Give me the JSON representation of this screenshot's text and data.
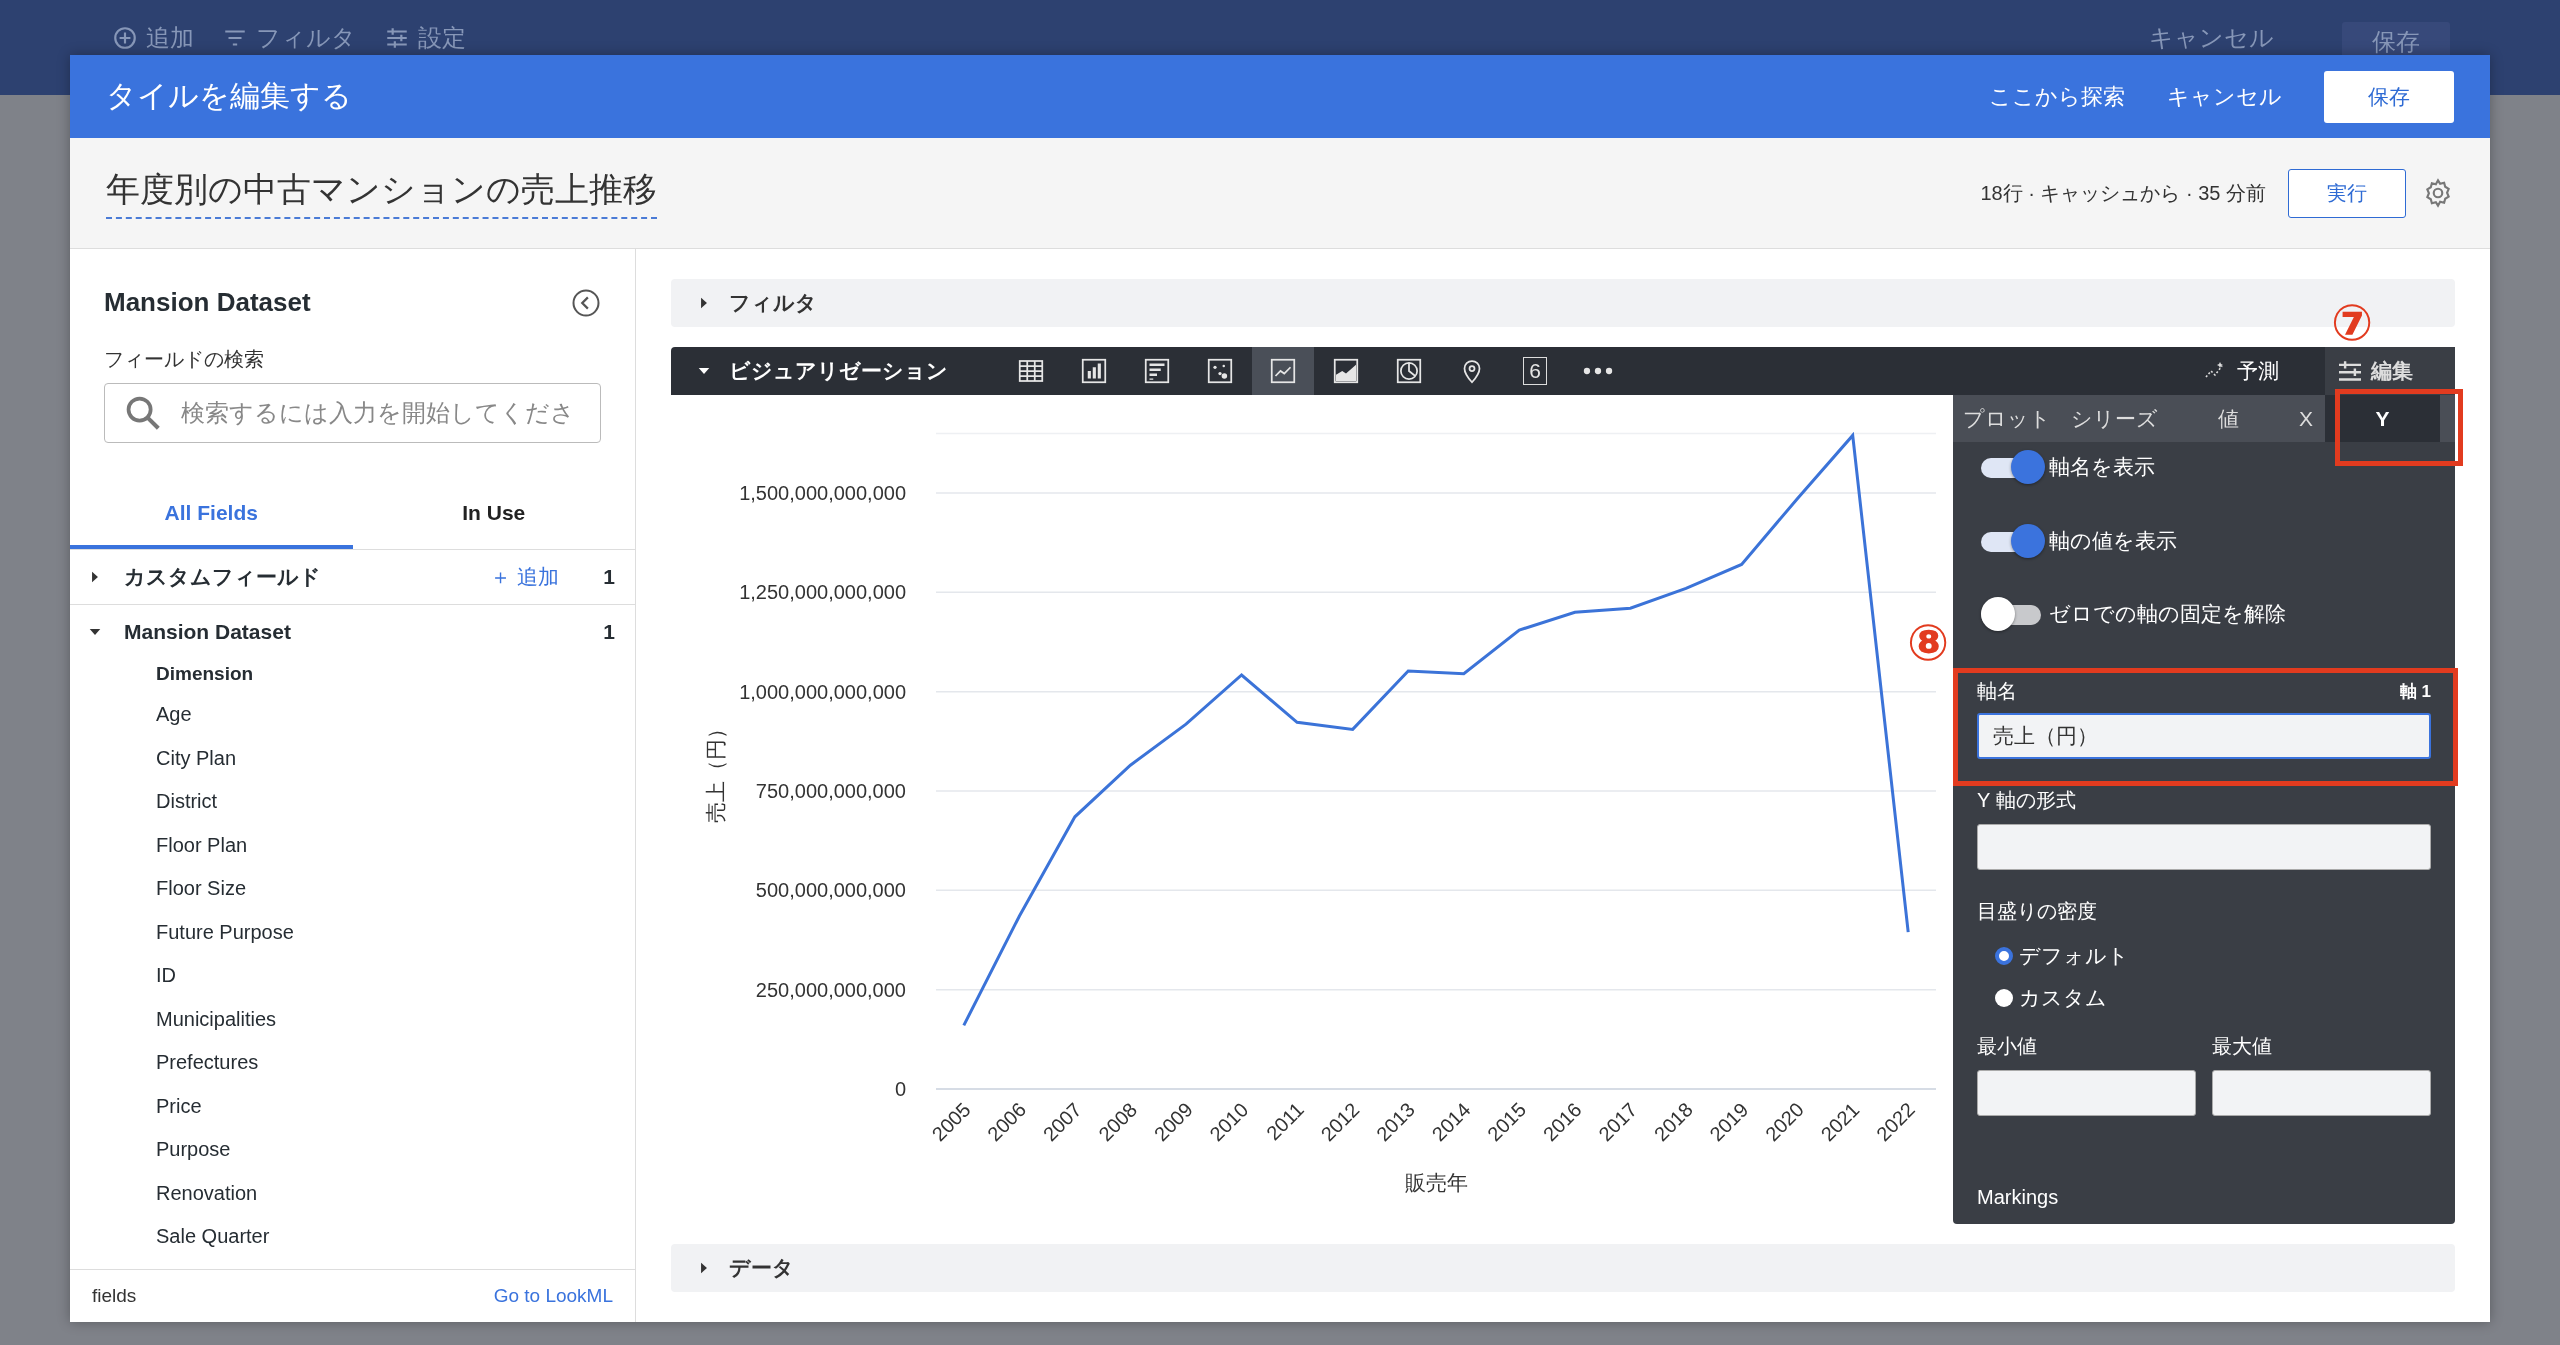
{
  "background_toolbar": {
    "left": [
      {
        "kind": "add",
        "label": "追加"
      },
      {
        "kind": "filter",
        "label": "フィルタ"
      },
      {
        "kind": "settings",
        "label": "設定"
      }
    ],
    "cancel": "キャンセル",
    "save": "保存"
  },
  "modal": {
    "title": "タイルを編集する",
    "actions": {
      "explore": "ここから探索",
      "cancel": "キャンセル",
      "save": "保存"
    },
    "tile_title": "年度別の中古マンションの売上推移",
    "status": "18行 · キャッシュから · 35 分前",
    "run": "実行",
    "field_picker": {
      "title": "Mansion Dataset",
      "search_label": "フィールドの検索",
      "search": {
        "placeholder": "検索するには入力を開始してくださ"
      },
      "tabs": [
        {
          "label": "All Fields",
          "selected": true
        },
        {
          "label": "In Use",
          "selected": false
        }
      ],
      "groups": [
        {
          "label": "カスタムフィールド",
          "expanded": false,
          "add": "＋ 追加",
          "count": "1"
        },
        {
          "label": "Mansion Dataset",
          "expanded": true,
          "count": "1",
          "section": "Dimension",
          "fields": [
            "Age",
            "City Plan",
            "District",
            "Floor Plan",
            "Floor Size",
            "Future Purpose",
            "ID",
            "Municipalities",
            "Prefectures",
            "Price",
            "Purpose",
            "Renovation",
            "Sale Quarter"
          ]
        }
      ],
      "footer": {
        "label": "fields",
        "link": "Go to LookML"
      }
    },
    "filter_section": {
      "label": "フィルタ",
      "expanded": false
    },
    "visualization": {
      "label": "ビジュアリゼーション",
      "expanded": true,
      "types": [
        {
          "kind": "table",
          "selected": false
        },
        {
          "kind": "column",
          "selected": false
        },
        {
          "kind": "bar",
          "selected": false
        },
        {
          "kind": "scatter",
          "selected": false
        },
        {
          "kind": "line",
          "selected": true
        },
        {
          "kind": "area",
          "selected": false
        },
        {
          "kind": "pie",
          "selected": false
        },
        {
          "kind": "map",
          "selected": false
        },
        {
          "kind": "single_value",
          "label": "6",
          "selected": false
        },
        {
          "kind": "more",
          "selected": false
        }
      ],
      "forecast": "予測",
      "edit": "編集",
      "chart_data": {
        "type": "line",
        "xlabel": "販売年",
        "ylabel": "売上（円）",
        "categories": [
          "2005",
          "2006",
          "2007",
          "2008",
          "2009",
          "2010",
          "2011",
          "2012",
          "2013",
          "2014",
          "2015",
          "2016",
          "2017",
          "2018",
          "2019",
          "2020",
          "2021",
          "2022"
        ],
        "series": [
          {
            "color": "#3b73d8",
            "values": [
              160000000000,
              435000000000,
              685000000000,
              815000000000,
              918000000000,
              1042000000000,
              923000000000,
              905000000000,
              1052000000000,
              1045000000000,
              1155000000000,
              1200000000000,
              1210000000000,
              1260000000000,
              1320000000000,
              1485000000000,
              1645000000000,
              395000000000
            ]
          }
        ],
        "grid": true,
        "ylim": [
          0,
          1650000000000
        ],
        "yticks": [
          {
            "value": 0,
            "label": "0"
          },
          {
            "value": 250000000000,
            "label": "250,000,000,000"
          },
          {
            "value": 500000000000,
            "label": "500,000,000,000"
          },
          {
            "value": 750000000000,
            "label": "750,000,000,000"
          },
          {
            "value": 1000000000000,
            "label": "1,000,000,000,000"
          },
          {
            "value": 1250000000000,
            "label": "1,250,000,000,000"
          },
          {
            "value": 1500000000000,
            "label": "1,500,000,000,000"
          }
        ]
      },
      "settings_panel": {
        "tabs": [
          {
            "label": "プロット",
            "selected": false
          },
          {
            "label": "シリーズ",
            "selected": false
          },
          {
            "label": "値",
            "selected": false
          },
          {
            "label": "X",
            "selected": false
          },
          {
            "label": "Y",
            "selected": true
          }
        ],
        "toggles": [
          {
            "label": "軸名を表示",
            "on": true
          },
          {
            "label": "軸の値を表示",
            "on": true
          },
          {
            "label": "ゼロでの軸の固定を解除",
            "on": false
          }
        ],
        "axis_name": {
          "label": "軸名",
          "badge": "軸 1",
          "value": "売上（円）"
        },
        "format": {
          "label": "Y 軸の形式"
        },
        "tick_density": {
          "label": "目盛りの密度",
          "options": [
            {
              "label": "デフォルト",
              "selected": true
            },
            {
              "label": "カスタム",
              "selected": false
            }
          ]
        },
        "min_label": "最小値",
        "max_label": "最大値",
        "markings": "Markings"
      }
    },
    "data_section": {
      "label": "データ",
      "expanded": false
    }
  },
  "annotations": [
    {
      "label": "⑦"
    },
    {
      "label": "⑧"
    }
  ]
}
